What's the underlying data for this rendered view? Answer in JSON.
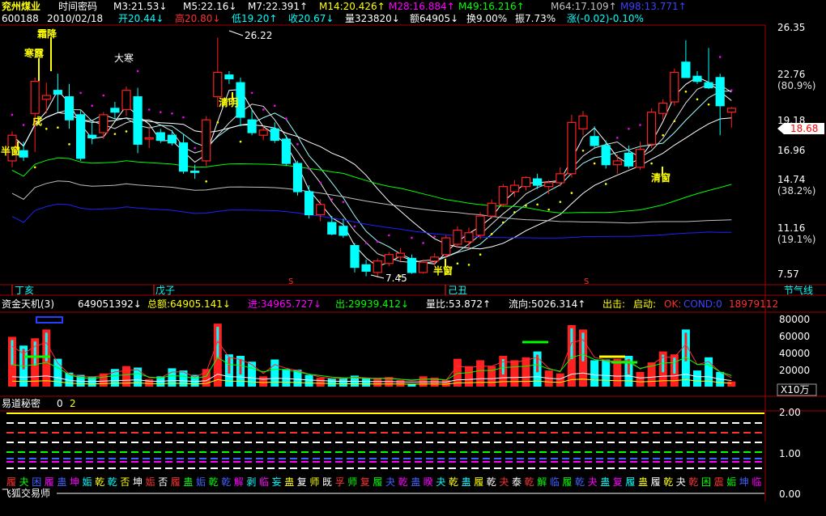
{
  "header": {
    "stock_name": "兖州煤业",
    "time_label": "时间密码",
    "code": "600188",
    "date": "2010/02/18",
    "ma3": "M3:21.53↓",
    "ma5": "M5:22.16↓",
    "ma7": "M7:22.391↑",
    "ma14": "M14:20.426↑",
    "ma28": "M28:16.884↑",
    "ma49": "M49:16.216↑",
    "ma64": "M64:17.109↑",
    "ma98": "M98:13.771↑",
    "open": "开20.44↓",
    "high": "高20.80↓",
    "low": "低19.20↑",
    "close": "收20.67↓",
    "volume": "量323820↓",
    "amount": "额64905↓",
    "turnover": "换9.00%",
    "amplitude": "振7.73%",
    "change": "涨(-0.02)-0.10%"
  },
  "colors": {
    "up": "#ff2020",
    "down": "#00ffff",
    "ma3": "#ffffff",
    "ma5": "#e0e0e0",
    "ma7": "#a0ffff",
    "ma14": "#ffffff",
    "ma28": "#ff00ff",
    "ma49": "#00ff00",
    "ma64": "#c0c0c0",
    "ma98": "#2020ff",
    "axis": "#a00000",
    "label_yellow": "#ffff00"
  },
  "price_axis": {
    "ticks": [
      "26.35",
      "22.76",
      "(80.9%)",
      "19.18",
      "16.96",
      "14.74",
      "(38.2%)",
      "11.16",
      "(19.1%)",
      "7.57"
    ],
    "current_price": "18.68"
  },
  "annotations": {
    "solar_terms": [
      "霜降",
      "寒露",
      "大寒",
      "清明",
      "半窗",
      "戌",
      "半窗",
      "清窗",
      "半窗"
    ],
    "high_label": "26.22",
    "low_label": "7.45",
    "period_labels": [
      "丁亥",
      "戊子",
      "己丑",
      "节气线"
    ],
    "s_marks": [
      "S",
      "S"
    ]
  },
  "volume_panel": {
    "title": "资金天机(3)",
    "value1": "649051392↓",
    "total_amount": "总额:64905.141↓",
    "in_flow": "进:34965.727↓",
    "out_flow": "出:29939.412↓",
    "ratio": "量比:53.872↑",
    "flow_dir": "流向:5026.314↑",
    "strike": "出击:",
    "start": "启动:",
    "ok": "OK:",
    "cond": "COND:0",
    "extra": "18979112",
    "ticks": [
      "80000",
      "60000",
      "40000",
      "20000"
    ],
    "unit": "X10万"
  },
  "indicator_panel": {
    "title": "易道秘密",
    "p1": "0",
    "p2": "2",
    "ticks": [
      "2.00",
      "1.00",
      "0.00"
    ],
    "hexagrams": [
      "履",
      "夬",
      "困",
      "履",
      "蛊",
      "坤",
      "姤",
      "乾",
      "乾",
      "否",
      "坤",
      "姤",
      "否",
      "履",
      "蛊",
      "姤",
      "乾",
      "乾",
      "解",
      "剥",
      "临",
      "妄",
      "蛊",
      "复",
      "师",
      "既",
      "孚",
      "师",
      "复",
      "履",
      "夬",
      "乾",
      "蛊",
      "睽",
      "夬",
      "乾",
      "蛊",
      "履",
      "乾",
      "夬",
      "泰",
      "乾",
      "解",
      "临",
      "履",
      "乾",
      "夬",
      "蛊",
      "复",
      "履",
      "蛊",
      "履",
      "乾",
      "夬",
      "乾",
      "困",
      "震",
      "姤",
      "坤",
      "临"
    ],
    "author": "飞狐交易师"
  },
  "chart_data": {
    "type": "candlestick",
    "ylim": [
      7.2,
      27.0
    ],
    "ohlc": [
      [
        16.6,
        18.9,
        16.1,
        18.6
      ],
      [
        17.4,
        18.1,
        16.6,
        16.9
      ],
      [
        20.3,
        23.1,
        17.3,
        22.8
      ],
      [
        21.4,
        22.7,
        20.3,
        21.7
      ],
      [
        22.1,
        23.4,
        20.4,
        21.8
      ],
      [
        21.6,
        22.6,
        19.1,
        19.8
      ],
      [
        20.2,
        20.6,
        16.6,
        16.8
      ],
      [
        18.6,
        19.6,
        17.9,
        18.4
      ],
      [
        18.8,
        20.4,
        18.3,
        20.2
      ],
      [
        20.7,
        21.2,
        19.9,
        20.4
      ],
      [
        20.6,
        22.4,
        20.1,
        22.1
      ],
      [
        21.6,
        22.3,
        17.2,
        17.9
      ],
      [
        18.3,
        19.3,
        17.6,
        18.4
      ],
      [
        18.8,
        19.1,
        18.0,
        18.2
      ],
      [
        18.6,
        19.0,
        17.8,
        18.0
      ],
      [
        18.0,
        18.7,
        15.6,
        15.8
      ],
      [
        15.8,
        16.3,
        15.2,
        15.7
      ],
      [
        16.6,
        20.1,
        16.2,
        19.8
      ],
      [
        21.6,
        26.2,
        20.8,
        23.5
      ],
      [
        23.3,
        23.6,
        22.6,
        23.0
      ],
      [
        22.7,
        23.1,
        19.3,
        20.0
      ],
      [
        19.8,
        20.6,
        18.6,
        18.8
      ],
      [
        18.6,
        19.3,
        18.2,
        19.0
      ],
      [
        19.1,
        19.6,
        18.0,
        18.2
      ],
      [
        18.3,
        18.6,
        16.2,
        16.4
      ],
      [
        16.4,
        16.6,
        13.9,
        14.2
      ],
      [
        14.2,
        14.7,
        12.1,
        12.4
      ],
      [
        12.4,
        13.6,
        11.9,
        13.2
      ],
      [
        11.8,
        12.3,
        10.8,
        10.9
      ],
      [
        11.5,
        12.1,
        10.6,
        10.8
      ],
      [
        10.0,
        10.2,
        7.9,
        8.3
      ],
      [
        8.5,
        8.9,
        7.6,
        8.0
      ],
      [
        7.9,
        9.0,
        7.5,
        8.8
      ],
      [
        8.6,
        9.5,
        8.4,
        9.3
      ],
      [
        9.1,
        9.8,
        8.8,
        9.4
      ],
      [
        9.0,
        9.3,
        7.8,
        7.9
      ],
      [
        7.9,
        8.9,
        7.8,
        8.7
      ],
      [
        8.8,
        9.4,
        8.4,
        9.1
      ],
      [
        9.3,
        10.8,
        9.0,
        10.6
      ],
      [
        10.1,
        11.5,
        9.8,
        11.2
      ],
      [
        10.3,
        11.4,
        9.7,
        11.0
      ],
      [
        10.8,
        12.6,
        10.5,
        12.3
      ],
      [
        12.3,
        13.6,
        12.1,
        13.3
      ],
      [
        13.2,
        14.8,
        13.0,
        14.6
      ],
      [
        14.2,
        15.1,
        13.8,
        14.7
      ],
      [
        14.6,
        15.4,
        14.3,
        15.3
      ],
      [
        15.2,
        15.6,
        14.4,
        14.7
      ],
      [
        14.6,
        15.1,
        14.0,
        14.9
      ],
      [
        14.9,
        16.1,
        14.6,
        15.6
      ],
      [
        15.6,
        20.2,
        15.3,
        19.6
      ],
      [
        19.1,
        20.5,
        18.6,
        20.1
      ],
      [
        18.5,
        19.3,
        17.6,
        17.8
      ],
      [
        17.8,
        18.2,
        16.0,
        16.3
      ],
      [
        16.3,
        17.1,
        15.6,
        16.6
      ],
      [
        17.2,
        17.8,
        16.0,
        16.2
      ],
      [
        16.1,
        18.1,
        15.9,
        17.5
      ],
      [
        17.9,
        20.7,
        17.6,
        20.4
      ],
      [
        20.3,
        21.4,
        19.8,
        21.1
      ],
      [
        21.2,
        23.8,
        20.9,
        23.5
      ],
      [
        24.3,
        26.0,
        23.2,
        23.1
      ],
      [
        23.2,
        23.6,
        22.6,
        22.8
      ],
      [
        22.7,
        25.4,
        22.2,
        22.3
      ],
      [
        23.1,
        23.4,
        18.6,
        20.9
      ],
      [
        20.4,
        20.8,
        19.2,
        20.7
      ]
    ],
    "volume": [
      [
        68000,
        55000,
        30000
      ],
      [
        56000,
        45000,
        28000
      ],
      [
        66000,
        55000,
        30000
      ],
      [
        78000,
        60000,
        33000
      ],
      [
        38000,
        32000,
        26000
      ],
      [
        19000,
        17000,
        16000
      ],
      [
        16000,
        14000,
        12000
      ],
      [
        14000,
        13000,
        11000
      ],
      [
        18000,
        15000,
        13000
      ],
      [
        24000,
        20000,
        15000
      ],
      [
        28000,
        22000,
        16000
      ],
      [
        26000,
        23000,
        18000
      ],
      [
        10000,
        12000,
        13000
      ],
      [
        14000,
        12000,
        12000
      ],
      [
        25000,
        20000,
        15000
      ],
      [
        22000,
        20000,
        14000
      ],
      [
        16000,
        13000,
        11000
      ],
      [
        24000,
        20000,
        14000
      ],
      [
        86000,
        62000,
        40000
      ],
      [
        44000,
        40000,
        30000
      ],
      [
        42000,
        37000,
        29000
      ],
      [
        34000,
        30000,
        25000
      ],
      [
        14000,
        18000,
        20000
      ],
      [
        37000,
        30000,
        24000
      ],
      [
        24000,
        25000,
        23000
      ],
      [
        23000,
        22000,
        20000
      ],
      [
        16000,
        17000,
        17000
      ],
      [
        12000,
        13000,
        15000
      ],
      [
        11000,
        11000,
        13000
      ],
      [
        12000,
        11000,
        12000
      ],
      [
        15000,
        13000,
        12000
      ],
      [
        12000,
        12000,
        11000
      ],
      [
        12000,
        11000,
        11000
      ],
      [
        13000,
        12000,
        11000
      ],
      [
        9000,
        10000,
        10000
      ],
      [
        4000,
        8000,
        9000
      ],
      [
        14000,
        10000,
        10000
      ],
      [
        12000,
        11000,
        10000
      ],
      [
        9000,
        9000,
        9000
      ],
      [
        38000,
        28000,
        18000
      ],
      [
        28000,
        26000,
        19000
      ],
      [
        36000,
        28000,
        22000
      ],
      [
        28000,
        28000,
        22000
      ],
      [
        42000,
        34000,
        26000
      ],
      [
        36000,
        33000,
        27000
      ],
      [
        40000,
        36000,
        28000
      ],
      [
        48000,
        40000,
        30000
      ],
      [
        22000,
        25000,
        24000
      ],
      [
        18000,
        20000,
        21000
      ],
      [
        84000,
        60000,
        40000
      ],
      [
        78000,
        64000,
        44000
      ],
      [
        36000,
        40000,
        37000
      ],
      [
        37000,
        36000,
        35000
      ],
      [
        38000,
        34000,
        32000
      ],
      [
        42000,
        36000,
        33000
      ],
      [
        20000,
        24000,
        25000
      ],
      [
        33000,
        30000,
        28000
      ],
      [
        48000,
        40000,
        32000
      ],
      [
        44000,
        40000,
        33000
      ],
      [
        78000,
        58000,
        40000
      ],
      [
        22000,
        30000,
        30000
      ],
      [
        40000,
        34000,
        30000
      ],
      [
        20000,
        20000,
        20000
      ],
      [
        7000,
        12000,
        15000
      ]
    ],
    "volume_ylim": [
      0,
      95000
    ]
  }
}
